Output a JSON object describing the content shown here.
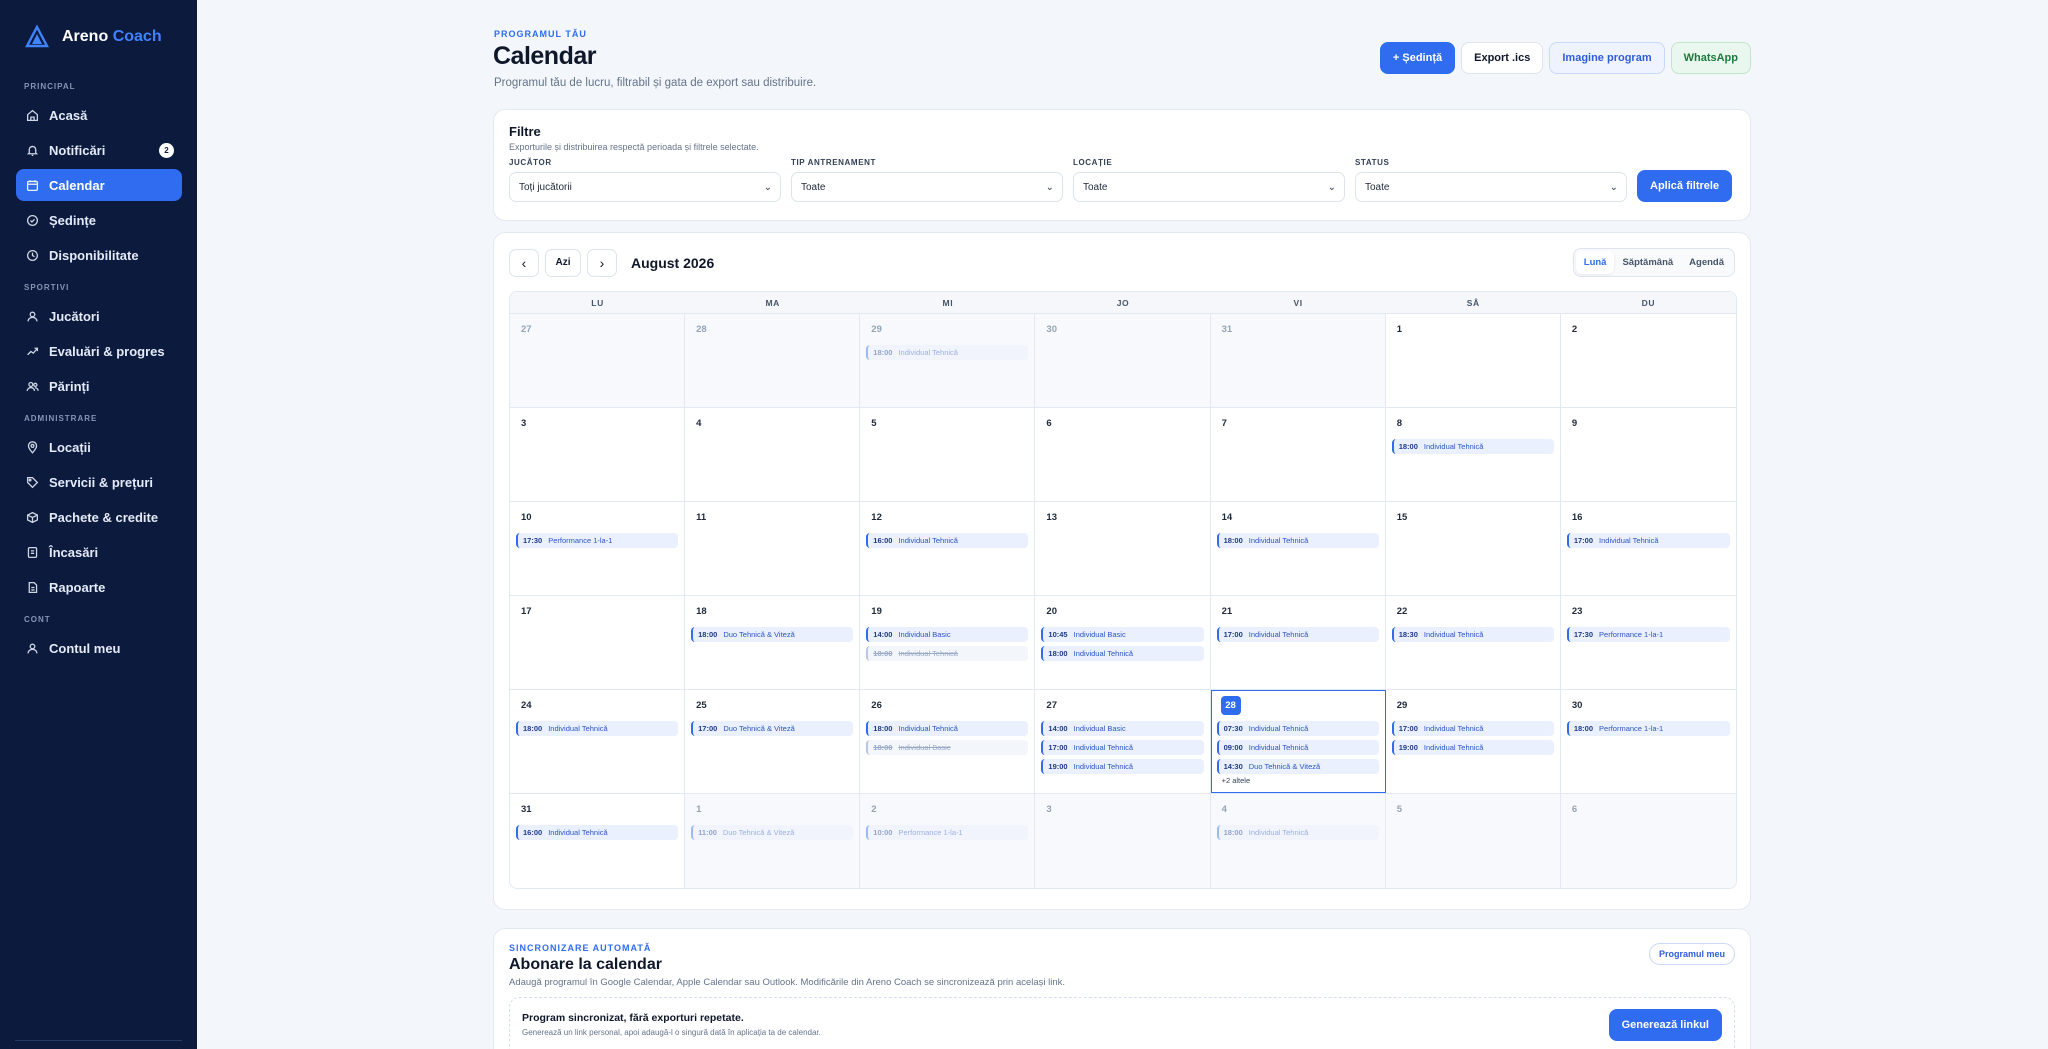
{
  "brand": {
    "name": "Areno",
    "accent": "Coach"
  },
  "sidebar": {
    "sections": [
      {
        "label": "PRINCIPAL",
        "items": [
          {
            "label": "Acasă",
            "icon": "home-icon"
          },
          {
            "label": "Notificări",
            "icon": "bell-icon",
            "badge": "2"
          },
          {
            "label": "Calendar",
            "icon": "calendar-icon",
            "active": true
          },
          {
            "label": "Ședințe",
            "icon": "check-circle-icon"
          },
          {
            "label": "Disponibilitate",
            "icon": "clock-icon"
          }
        ]
      },
      {
        "label": "SPORTIVI",
        "items": [
          {
            "label": "Jucători",
            "icon": "user-icon"
          },
          {
            "label": "Evaluări & progres",
            "icon": "trend-icon"
          },
          {
            "label": "Părinți",
            "icon": "users-icon"
          }
        ]
      },
      {
        "label": "ADMINISTRARE",
        "items": [
          {
            "label": "Locații",
            "icon": "pin-icon"
          },
          {
            "label": "Servicii & prețuri",
            "icon": "tag-icon"
          },
          {
            "label": "Pachete & credite",
            "icon": "box-icon"
          },
          {
            "label": "Încasări",
            "icon": "wallet-icon"
          },
          {
            "label": "Rapoarte",
            "icon": "doc-icon"
          }
        ]
      },
      {
        "label": "CONT",
        "items": [
          {
            "label": "Contul meu",
            "icon": "user-icon"
          }
        ]
      }
    ]
  },
  "header": {
    "eyebrow": "PROGRAMUL TĂU",
    "title": "Calendar",
    "subtitle": "Programul tău de lucru, filtrabil și gata de export sau distribuire.",
    "actions": {
      "new_session": "+ Ședință",
      "export_ics": "Export .ics",
      "image": "Imagine program",
      "whatsapp": "WhatsApp"
    }
  },
  "filters": {
    "title": "Filtre",
    "hint": "Exporturile și distribuirea respectă perioada și filtrele selectate.",
    "fields": [
      {
        "label": "JUCĂTOR",
        "value": "Toți jucătorii"
      },
      {
        "label": "TIP ANTRENAMENT",
        "value": "Toate"
      },
      {
        "label": "LOCAȚIE",
        "value": "Toate"
      },
      {
        "label": "STATUS",
        "value": "Toate"
      }
    ],
    "apply": "Aplică filtrele"
  },
  "calendar": {
    "prev": "‹",
    "today": "Azi",
    "next": "›",
    "month": "August 2026",
    "views": [
      "Lună",
      "Săptămână",
      "Agendă"
    ],
    "active_view": "Lună",
    "dow": [
      "LU",
      "MA",
      "MI",
      "JO",
      "VI",
      "SÂ",
      "DU"
    ],
    "weeks": [
      [
        {
          "n": "27",
          "muted": true,
          "events": []
        },
        {
          "n": "28",
          "muted": true,
          "events": []
        },
        {
          "n": "29",
          "muted": true,
          "events": [
            {
              "t": "18:00",
              "name": "Individual Tehnică",
              "state": "faded"
            }
          ]
        },
        {
          "n": "30",
          "muted": true,
          "events": []
        },
        {
          "n": "31",
          "muted": true,
          "events": []
        },
        {
          "n": "1",
          "events": []
        },
        {
          "n": "2",
          "events": []
        }
      ],
      [
        {
          "n": "3",
          "events": []
        },
        {
          "n": "4",
          "events": []
        },
        {
          "n": "5",
          "events": []
        },
        {
          "n": "6",
          "events": []
        },
        {
          "n": "7",
          "events": []
        },
        {
          "n": "8",
          "events": [
            {
              "t": "18:00",
              "name": "Individual Tehnică"
            }
          ]
        },
        {
          "n": "9",
          "events": []
        }
      ],
      [
        {
          "n": "10",
          "events": [
            {
              "t": "17:30",
              "name": "Performance 1-la-1"
            }
          ]
        },
        {
          "n": "11",
          "events": []
        },
        {
          "n": "12",
          "events": [
            {
              "t": "16:00",
              "name": "Individual Tehnică"
            }
          ]
        },
        {
          "n": "13",
          "events": []
        },
        {
          "n": "14",
          "events": [
            {
              "t": "18:00",
              "name": "Individual Tehnică"
            }
          ]
        },
        {
          "n": "15",
          "events": []
        },
        {
          "n": "16",
          "events": [
            {
              "t": "17:00",
              "name": "Individual Tehnică"
            }
          ]
        }
      ],
      [
        {
          "n": "17",
          "events": []
        },
        {
          "n": "18",
          "events": [
            {
              "t": "18:00",
              "name": "Duo Tehnică & Viteză"
            }
          ]
        },
        {
          "n": "19",
          "events": [
            {
              "t": "14:00",
              "name": "Individual Basic"
            },
            {
              "t": "18:00",
              "name": "Individual Tehnică",
              "state": "cancel"
            }
          ]
        },
        {
          "n": "20",
          "events": [
            {
              "t": "10:45",
              "name": "Individual Basic"
            },
            {
              "t": "18:00",
              "name": "Individual Tehnică"
            }
          ]
        },
        {
          "n": "21",
          "events": [
            {
              "t": "17:00",
              "name": "Individual Tehnică"
            }
          ]
        },
        {
          "n": "22",
          "events": [
            {
              "t": "18:30",
              "name": "Individual Tehnică"
            }
          ]
        },
        {
          "n": "23",
          "events": [
            {
              "t": "17:30",
              "name": "Performance 1-la-1"
            }
          ]
        }
      ],
      [
        {
          "n": "24",
          "events": [
            {
              "t": "18:00",
              "name": "Individual Tehnică"
            }
          ]
        },
        {
          "n": "25",
          "events": [
            {
              "t": "17:00",
              "name": "Duo Tehnică & Viteză"
            }
          ]
        },
        {
          "n": "26",
          "events": [
            {
              "t": "18:00",
              "name": "Individual Tehnică"
            },
            {
              "t": "18:00",
              "name": "Individual Basic",
              "state": "cancel"
            }
          ]
        },
        {
          "n": "27",
          "events": [
            {
              "t": "14:00",
              "name": "Individual Basic"
            },
            {
              "t": "17:00",
              "name": "Individual Tehnică"
            },
            {
              "t": "19:00",
              "name": "Individual Tehnică"
            }
          ]
        },
        {
          "n": "28",
          "today": true,
          "events": [
            {
              "t": "07:30",
              "name": "Individual Tehnică"
            },
            {
              "t": "09:00",
              "name": "Individual Tehnică"
            },
            {
              "t": "14:30",
              "name": "Duo Tehnică & Viteză"
            }
          ],
          "more": "+2 altele"
        },
        {
          "n": "29",
          "events": [
            {
              "t": "17:00",
              "name": "Individual Tehnică"
            },
            {
              "t": "19:00",
              "name": "Individual Tehnică"
            }
          ]
        },
        {
          "n": "30",
          "events": [
            {
              "t": "18:00",
              "name": "Performance 1-la-1"
            }
          ]
        }
      ],
      [
        {
          "n": "31",
          "events": [
            {
              "t": "16:00",
              "name": "Individual Tehnică"
            }
          ]
        },
        {
          "n": "1",
          "muted": true,
          "events": [
            {
              "t": "11:00",
              "name": "Duo Tehnică & Viteză",
              "state": "faded"
            }
          ]
        },
        {
          "n": "2",
          "muted": true,
          "events": [
            {
              "t": "10:00",
              "name": "Performance 1-la-1",
              "state": "faded"
            }
          ]
        },
        {
          "n": "3",
          "muted": true,
          "events": []
        },
        {
          "n": "4",
          "muted": true,
          "events": [
            {
              "t": "18:00",
              "name": "Individual Tehnică",
              "state": "faded"
            }
          ]
        },
        {
          "n": "5",
          "muted": true,
          "events": []
        },
        {
          "n": "6",
          "muted": true,
          "events": []
        }
      ]
    ]
  },
  "sync": {
    "eyebrow": "SINCRONIZARE AUTOMATĂ",
    "title": "Abonare la calendar",
    "subtitle": "Adaugă programul în Google Calendar, Apple Calendar sau Outlook. Modificările din Areno Coach se sincronizează prin același link.",
    "pill": "Programul meu",
    "box_title": "Program sincronizat, fără exporturi repetate.",
    "box_sub": "Generează un link personal, apoi adaugă-l o singură dată în aplicația ta de calendar.",
    "generate": "Generează linkul"
  },
  "colors": {
    "accent": "#2f6cf0",
    "sidebar_bg": "#0b1a3d",
    "event_bg": "#eaf0fd"
  }
}
